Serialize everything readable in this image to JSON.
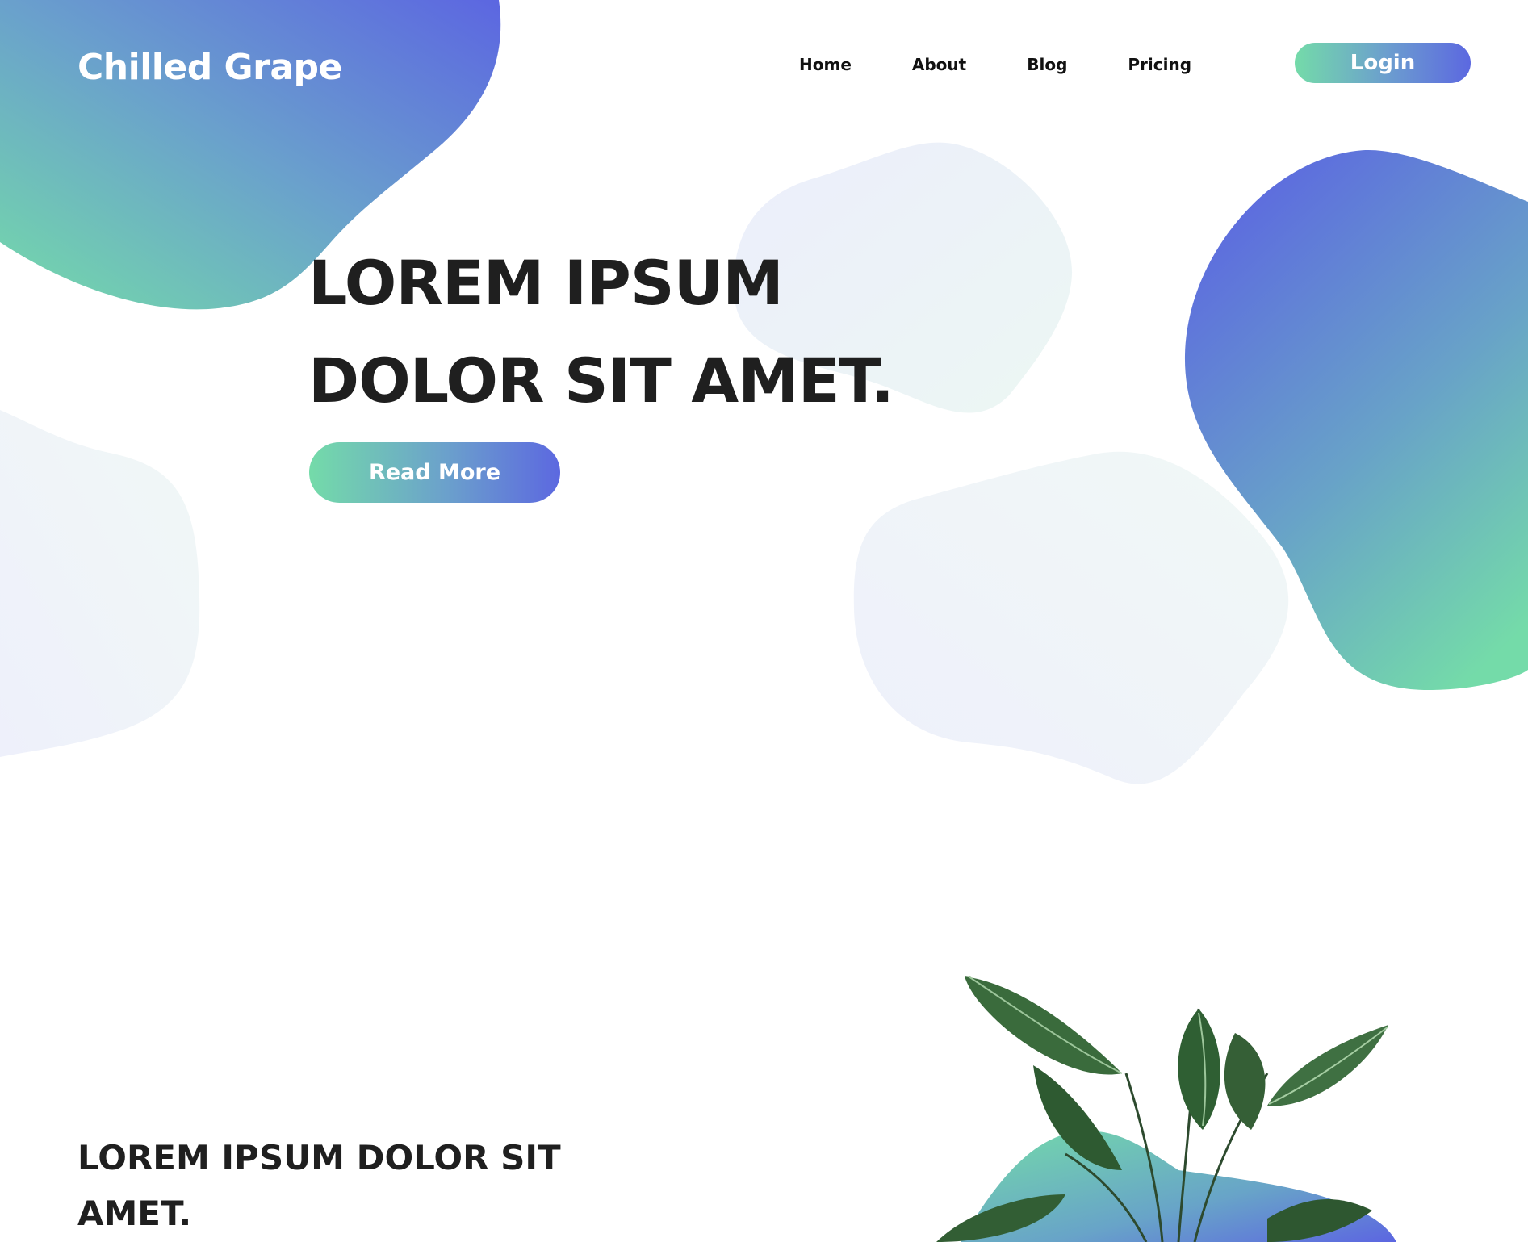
{
  "header": {
    "brand": "Chilled Grape",
    "nav": [
      {
        "label": "Home"
      },
      {
        "label": "About"
      },
      {
        "label": "Blog"
      },
      {
        "label": "Pricing"
      }
    ],
    "login_label": "Login"
  },
  "hero": {
    "heading_line1": "LOREM IPSUM",
    "heading_line2": "DOLOR SIT AMET.",
    "cta_label": "Read More"
  },
  "section": {
    "heading": "LOREM IPSUM DOLOR SIT AMET."
  },
  "icons": [
    "plant-image"
  ],
  "colors": {
    "gradient_green": "#74dba9",
    "gradient_blue": "#5c68e0",
    "text_dark": "#1f1f1f",
    "blob_light": "#edf1fa"
  }
}
